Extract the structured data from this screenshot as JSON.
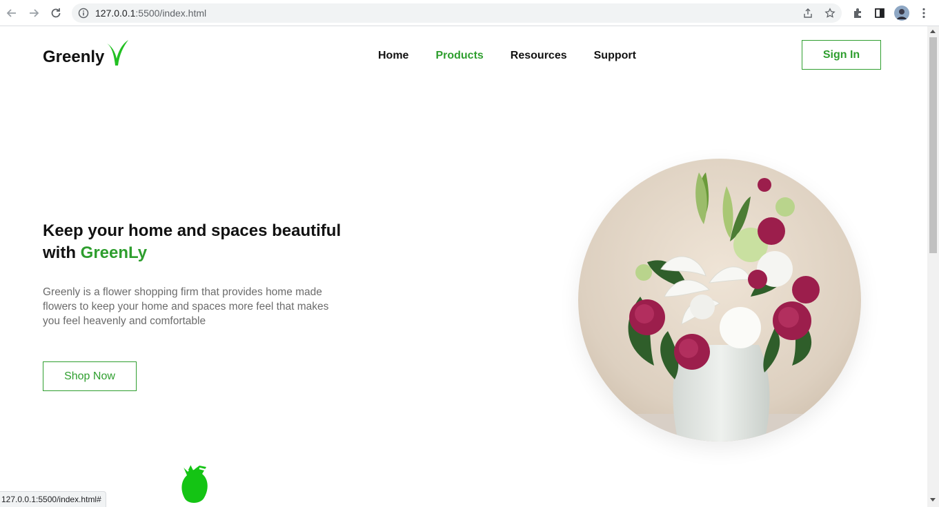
{
  "browser": {
    "url_host": "127.0.0.1",
    "url_path": ":5500/index.html",
    "status_url": "127.0.0.1:5500/index.html#"
  },
  "header": {
    "logo_text": "Greenly",
    "nav": [
      {
        "label": "Home",
        "active": false
      },
      {
        "label": "Products",
        "active": true
      },
      {
        "label": "Resources",
        "active": false
      },
      {
        "label": "Support",
        "active": false
      }
    ],
    "signin_label": "Sign In"
  },
  "hero": {
    "title_prefix": "Keep your home and spaces beautiful with ",
    "title_brand": "GreenLy",
    "description": "Greenly is a flower shopping firm that provides home made flowers to keep your home and spaces more feel that makes you feel heavenly and comfortable",
    "cta_label": "Shop Now"
  },
  "colors": {
    "accent": "#2e9e2e",
    "logo_mark": "#22c022",
    "text": "#111111",
    "muted": "#6b6b6b"
  },
  "icons": [
    "back-arrow-icon",
    "forward-arrow-icon",
    "reload-icon",
    "info-icon",
    "share-icon",
    "star-icon",
    "extensions-icon",
    "sidepanel-icon",
    "profile-avatar",
    "more-icon",
    "logo-check-icon",
    "rose-icon"
  ]
}
